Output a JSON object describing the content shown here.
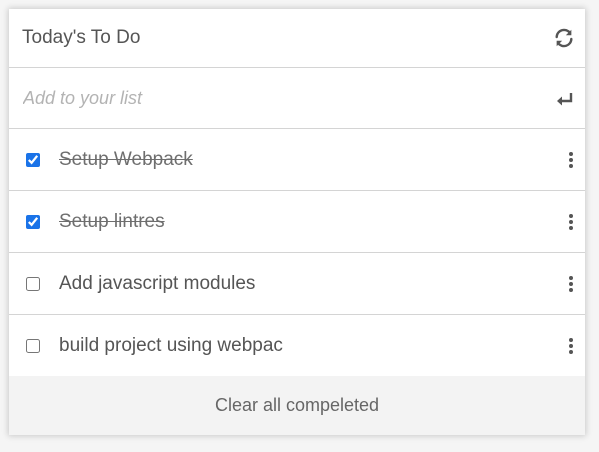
{
  "header": {
    "title": "Today's To Do",
    "refresh_icon": "refresh-icon"
  },
  "add": {
    "placeholder": "Add to your list",
    "value": "",
    "enter_icon": "enter-icon"
  },
  "items": [
    {
      "label": "Setup Webpack",
      "completed": true
    },
    {
      "label": "Setup lintres",
      "completed": true
    },
    {
      "label": "Add javascript modules",
      "completed": false
    },
    {
      "label": "build project using webpac",
      "completed": false
    }
  ],
  "footer": {
    "clear_label": "Clear all compeleted"
  },
  "colors": {
    "checkbox_accent": "#1a73e8",
    "text": "#555555",
    "placeholder": "#b3b3b3",
    "footer_bg": "#f3f3f3"
  }
}
